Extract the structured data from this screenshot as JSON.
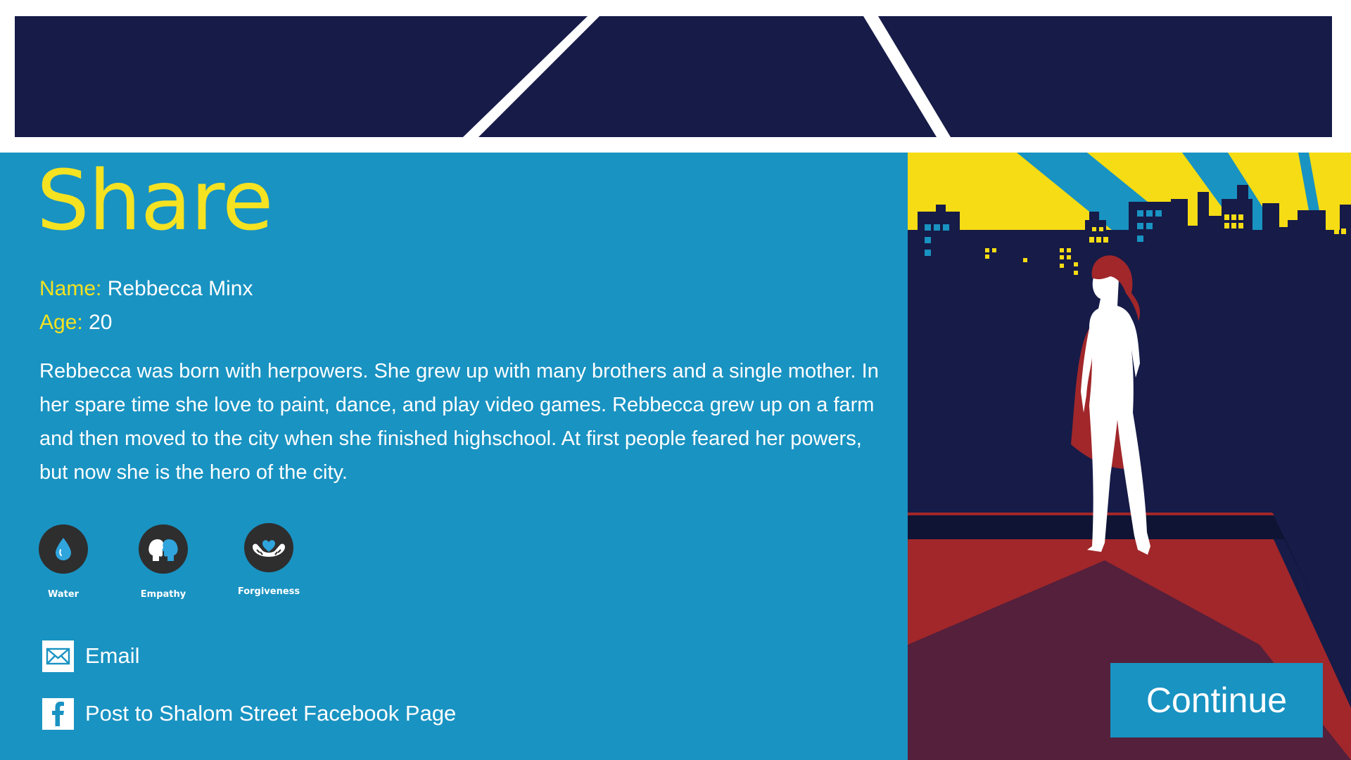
{
  "colors": {
    "navy": "#161b48",
    "panel_blue": "#1993c2",
    "accent_yellow": "#f5e221",
    "cape_red": "#a1272a",
    "icon_dark": "#2e2e2e"
  },
  "page": {
    "title": "Share"
  },
  "profile": {
    "name_label": "Name:",
    "name_value": "Rebbecca Minx",
    "age_label": "Age:",
    "age_value": "20",
    "bio": "Rebbecca was born with herpowers. She grew up with many brothers and a single mother. In her spare time she love to paint, dance, and play video games. Rebbecca grew up on a farm and then moved to the city when she finished highschool. At first people feared her powers, but now she is the hero of the city."
  },
  "powers": [
    {
      "label": "Water",
      "icon": "water-drop-icon"
    },
    {
      "label": "Empathy",
      "icon": "empathy-heads-icon"
    },
    {
      "label": "Forgiveness",
      "icon": "heart-hands-icon"
    }
  ],
  "share_actions": {
    "email_label": "Email",
    "email_icon": "envelope-icon",
    "facebook_label": "Post to Shalom Street Facebook Page",
    "facebook_icon": "facebook-icon"
  },
  "continue_button": {
    "label": "Continue"
  }
}
